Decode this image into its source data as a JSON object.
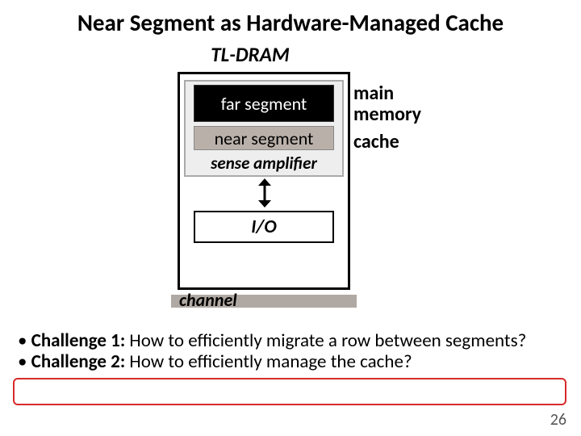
{
  "title": "Near Segment as Hardware-Managed Cache",
  "subtitle": "TL-DRAM",
  "diagram": {
    "far_segment": "far segment",
    "near_segment": "near segment",
    "sense_amp": "sense amplifier",
    "io": "I/O",
    "channel": "channel",
    "annotations": {
      "main_memory_l1": "main",
      "main_memory_l2": "memory",
      "cache": "cache"
    }
  },
  "challenges": {
    "c1_label": "Challenge 1:",
    "c1_text": " How to efficiently migrate a row between segments?",
    "c2_label": "Challenge 2:",
    "c2_text": " How to efficiently manage the cache?"
  },
  "page_number": "26"
}
